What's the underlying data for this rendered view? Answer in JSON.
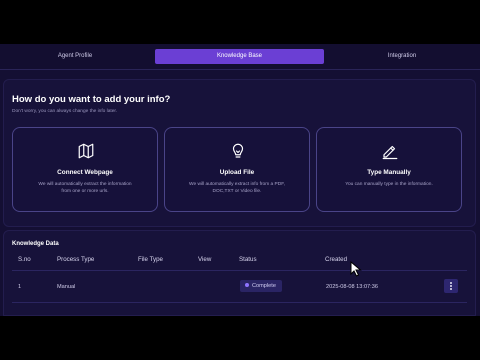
{
  "tabs": [
    {
      "label": "Agent Profile",
      "active": false
    },
    {
      "label": "Knowledge Base",
      "active": true
    },
    {
      "label": "Integration",
      "active": false
    }
  ],
  "add_info": {
    "title": "How do you want to add your info?",
    "subtitle": "Don't worry, you can always change the info later.",
    "cards": [
      {
        "icon": "map-icon",
        "title": "Connect Webpage",
        "description": "We will automatically extract the information from one or more urls."
      },
      {
        "icon": "lightbulb-icon",
        "title": "Upload File",
        "description": "We will automatically extract info from a PDF, DOC,TXT or Video file."
      },
      {
        "icon": "pencil-icon",
        "title": "Type Manually",
        "description": "You can manually type in the information."
      }
    ]
  },
  "knowledge_data": {
    "title": "Knowledge Data",
    "columns": [
      "S.no",
      "Process Type",
      "File Type",
      "View",
      "Status",
      "Created"
    ],
    "rows": [
      {
        "sno": "1",
        "process_type": "Manual",
        "file_type": "",
        "view": "",
        "status": "Complete",
        "created": "2025-08-08 13:07:36"
      }
    ]
  },
  "colors": {
    "accent": "#6b3fd4",
    "background": "#140f33",
    "panel": "#17123a",
    "card_border": "#4a4488",
    "status_dot": "#8f74ff"
  }
}
